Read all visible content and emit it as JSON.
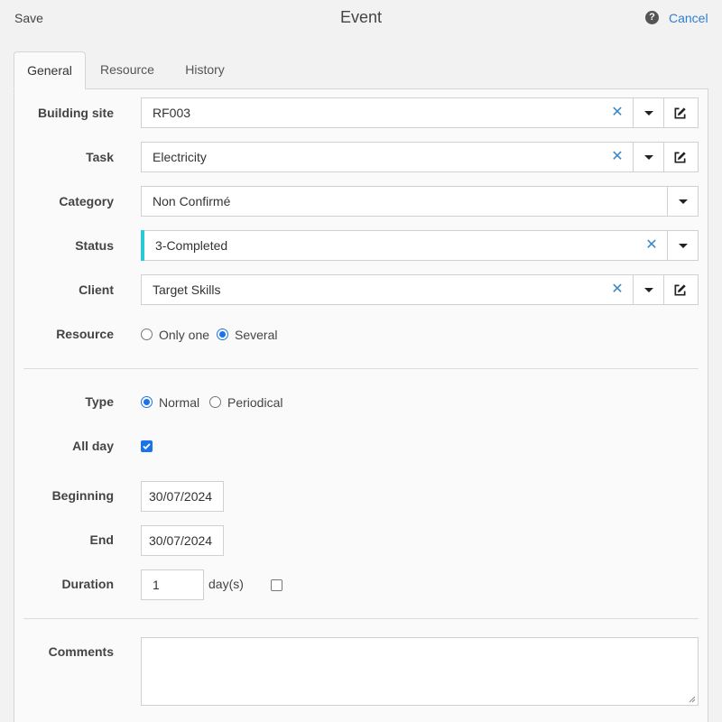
{
  "header": {
    "save_label": "Save",
    "title": "Event",
    "help_icon": "?",
    "cancel_label": "Cancel"
  },
  "tabs": [
    {
      "label": "General",
      "active": true
    },
    {
      "label": "Resource",
      "active": false
    },
    {
      "label": "History",
      "active": false
    }
  ],
  "form": {
    "building_site": {
      "label": "Building site",
      "value": "RF003"
    },
    "task": {
      "label": "Task",
      "value": "Electricity"
    },
    "category": {
      "label": "Category",
      "value": "Non Confirmé"
    },
    "status": {
      "label": "Status",
      "value": "3-Completed"
    },
    "client": {
      "label": "Client",
      "value": "Target Skills"
    },
    "resource": {
      "label": "Resource",
      "options": [
        "Only one",
        "Several"
      ],
      "selected": "Several"
    },
    "type": {
      "label": "Type",
      "options": [
        "Normal",
        "Periodical"
      ],
      "selected": "Normal"
    },
    "all_day": {
      "label": "All day",
      "checked": true
    },
    "beginning": {
      "label": "Beginning",
      "value": "30/07/2024"
    },
    "end": {
      "label": "End",
      "value": "30/07/2024"
    },
    "duration": {
      "label": "Duration",
      "value": "1",
      "unit": "day(s)",
      "checked": false
    },
    "comments": {
      "label": "Comments",
      "value": ""
    }
  },
  "colors": {
    "accent": "#1a73e8",
    "link": "#2f7fd0",
    "clear_icon": "#3a87c8",
    "status_bar": "#28c9d2"
  }
}
